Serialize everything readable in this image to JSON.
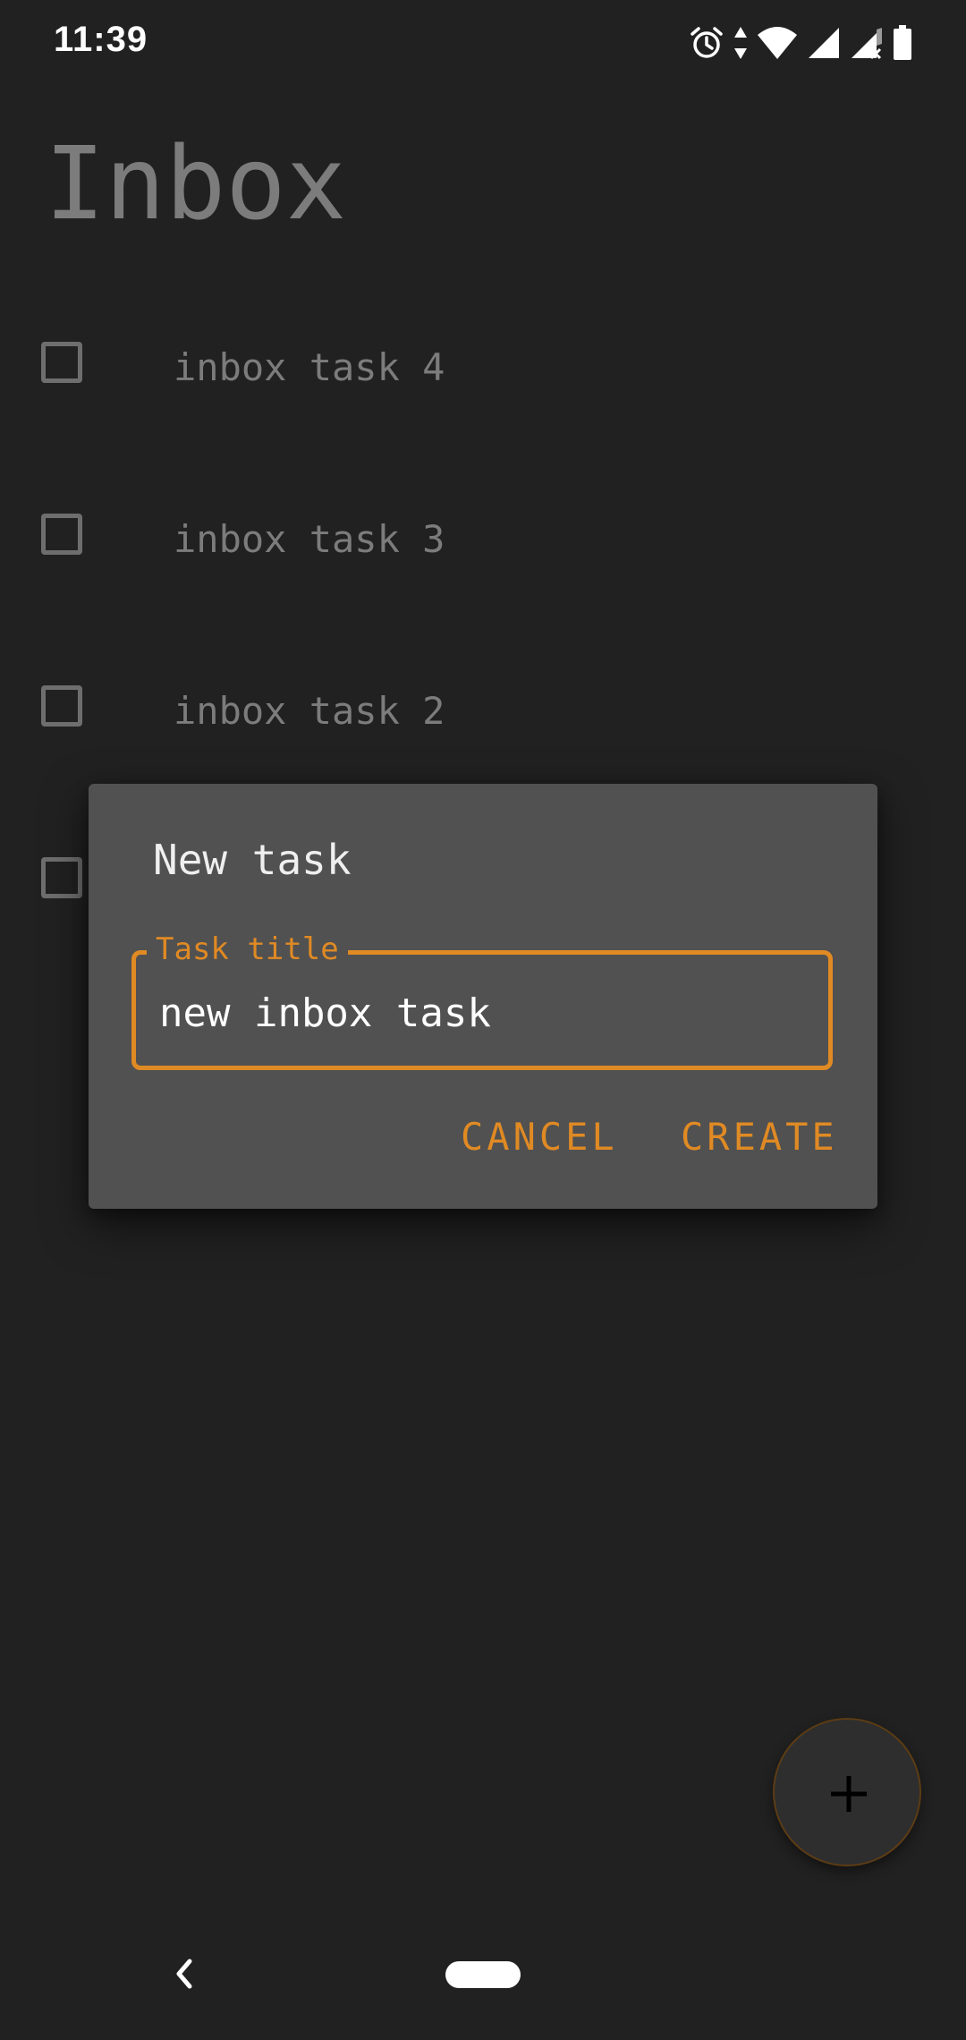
{
  "status_bar": {
    "time": "11:39",
    "icons": [
      "alarm-icon",
      "data-arrows-icon",
      "wifi-icon",
      "signal-icon",
      "signal-no-data-icon",
      "battery-icon"
    ]
  },
  "page": {
    "title": "Inbox",
    "tasks": [
      {
        "label": "inbox task 4",
        "checked": false
      },
      {
        "label": "inbox task 3",
        "checked": false
      },
      {
        "label": "inbox task 2",
        "checked": false
      },
      {
        "label": "",
        "checked": false
      }
    ]
  },
  "dialog": {
    "title": "New task",
    "field_label": "Task title",
    "field_value": "new inbox task",
    "cancel_label": "CANCEL",
    "create_label": "CREATE"
  },
  "fab": {
    "icon": "plus-icon"
  },
  "nav_bar": {
    "back_icon": "back-chevron-icon",
    "home_icon": "home-pill-icon"
  },
  "colors": {
    "background": "#212121",
    "dialog": "#515151",
    "accent": "#e08a24",
    "dimmed_text": "#7c7c7c"
  }
}
